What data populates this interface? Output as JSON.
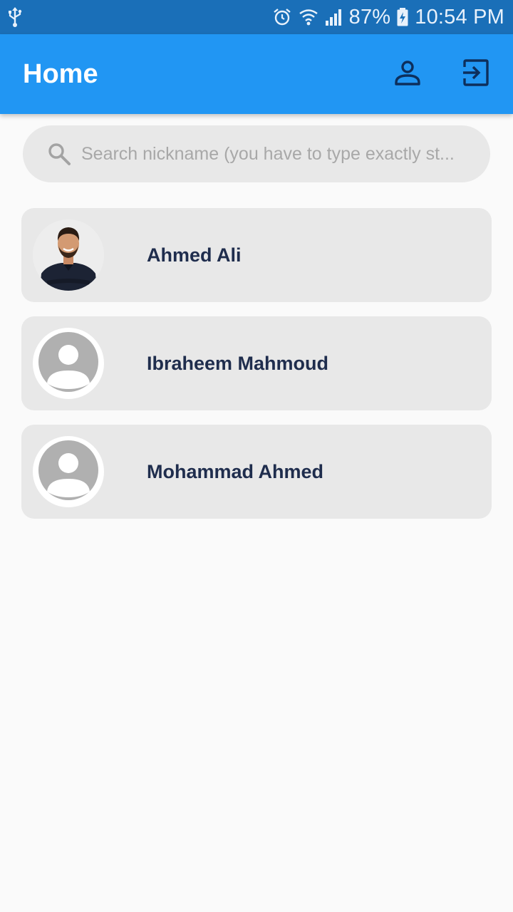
{
  "status_bar": {
    "battery": "87%",
    "time": "10:54 PM",
    "icons": [
      "usb-icon",
      "alarm-icon",
      "wifi-icon",
      "signal-icon",
      "battery-charging-icon"
    ]
  },
  "app_bar": {
    "title": "Home",
    "actions": [
      "profile-icon",
      "logout-icon"
    ]
  },
  "search": {
    "placeholder": "Search nickname (you have to type exactly st..."
  },
  "users": [
    {
      "name": "Ahmed Ali",
      "avatar": "photo"
    },
    {
      "name": "Ibraheem Mahmoud",
      "avatar": "default-account-icon"
    },
    {
      "name": "Mohammad Ahmed",
      "avatar": "default-account-icon"
    }
  ],
  "colors": {
    "status_bar": "#1a6fb8",
    "app_bar": "#2196f3",
    "card": "#e8e8e8",
    "name_text": "#1f2d4d",
    "action_icon": "#0d2f5c"
  }
}
